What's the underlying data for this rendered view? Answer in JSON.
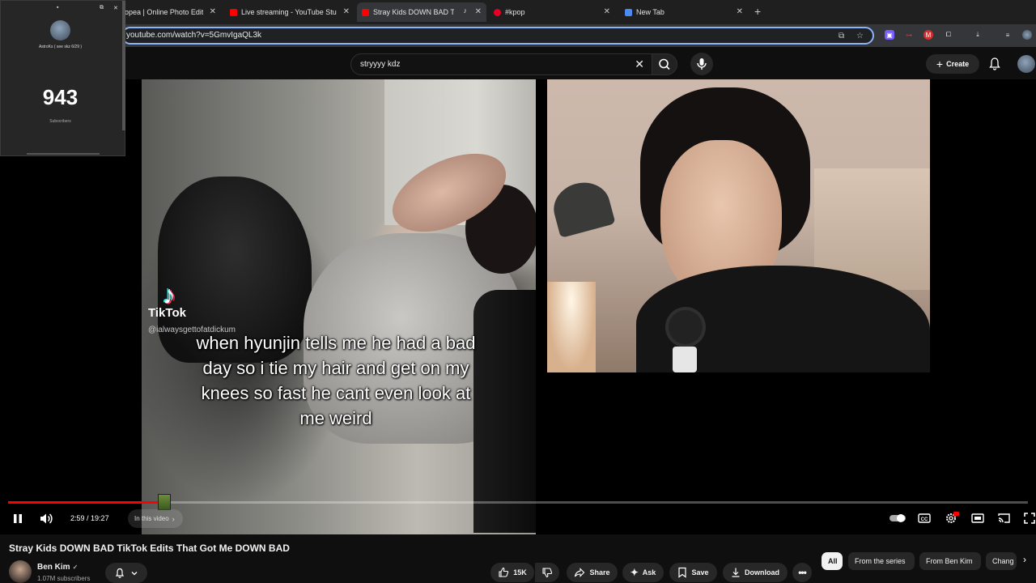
{
  "browser": {
    "tabs": [
      {
        "title": "opea | Online Photo Edit",
        "favicon_color": "#1a1a1a",
        "active": false
      },
      {
        "title": "Live streaming - YouTube Stu",
        "favicon_color": "#ff0000",
        "active": false
      },
      {
        "title": "Stray Kids DOWN BAD Ti",
        "favicon_color": "#ff0000",
        "active": true,
        "audio": "♪"
      },
      {
        "title": "#kpop",
        "favicon_color": "#e60023",
        "active": false
      },
      {
        "title": "New Tab",
        "favicon_color": "#4c8bf5",
        "active": false
      }
    ],
    "url": "youtube.com/watch?v=5GmvIgaQL3k"
  },
  "overlay": {
    "channel_name": "AstroKs ( see skz 6/29 )",
    "subscriber_count": "943",
    "subscriber_label": "Subscribers"
  },
  "masthead": {
    "search_query": "stryyyy kdz",
    "create_label": "Create"
  },
  "video": {
    "tiktok_wordmark": "TikTok",
    "tiktok_handle": "@ialwaysgettofatdickum",
    "caption": "when hyunjin tells me he had a bad day so i tie my hair and get on my knees so fast he cant even look at me weird",
    "current_time": "2:59",
    "duration": "19:27",
    "progress_fraction": 0.153,
    "chapter_label": "In this video"
  },
  "details": {
    "title": "Stray Kids DOWN BAD TikTok Edits That Got Me DOWN BAD",
    "channel": "Ben Kim",
    "subscribers": "1.07M subscribers",
    "likes": "15K",
    "share_label": "Share",
    "ask_label": "Ask",
    "save_label": "Save",
    "download_label": "Download"
  },
  "chips": [
    "All",
    "From the series",
    "From Ben Kim",
    "Chang"
  ],
  "colors": {
    "accent": "#ff0000",
    "omnibox_focus": "#8ab4f8"
  }
}
